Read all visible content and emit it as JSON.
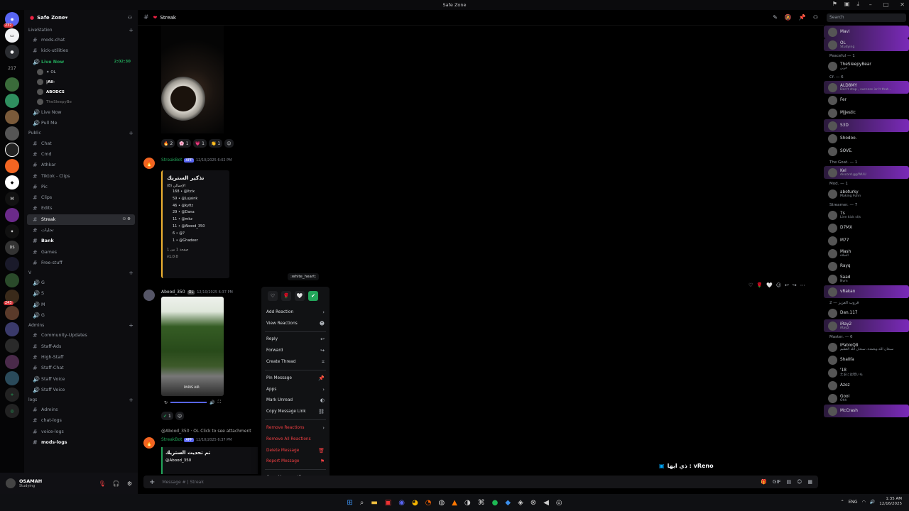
{
  "titlebar": {
    "title": "Safe Zone"
  },
  "server_list": {
    "badge_top": "232",
    "badge_2": "217",
    "badge_3": "243"
  },
  "guild": {
    "name": "Safe Zone"
  },
  "channels": {
    "cat_livestation": "LiveStation",
    "mods_chat": "mods-chat",
    "kick_utilities": "kick-utilities",
    "live_now_1": "Live Now",
    "live_now_time": "2:02:30",
    "vc_user_1": "|All-",
    "vc_user_2": "ABODCS",
    "vc_user_3": "TheSleepyBe",
    "live_now_2": "Live Now",
    "pull_me": "Pull Me",
    "cat_public": "Public",
    "chat": "Chat",
    "cmd": "Cmd",
    "athkar": "Athkar",
    "tiktok": "Tiktok - Clips",
    "pic": "Pic",
    "clips": "Clips",
    "edits": "Edits",
    "streak": "Streak",
    "tahliyat": "تحليات",
    "bank": "Bank",
    "games": "Games",
    "free_stuff": "Free-stuff",
    "cat_v": "V",
    "vg1": "G",
    "vs": "S",
    "vm": "M",
    "vg2": "G",
    "cat_admins": "Admins",
    "community_updates": "Community-Updates",
    "staff_ads": "Staff-Ads",
    "high_staff": "High-Staff",
    "staff_chat": "Staff-Chat",
    "staff_voice_1": "Staff Voice",
    "staff_voice_2": "Staff Voice",
    "cat_logs": "logs",
    "admins": "Admins",
    "chat_logs": "chat-logs",
    "voice_logs": "voice-logs",
    "mods_logs": "mods-logs"
  },
  "user_panel": {
    "name": "OSAMAH",
    "status": "Studying"
  },
  "header": {
    "channel": "Streak",
    "search_placeholder": "Search"
  },
  "messages": {
    "reactions": [
      {
        "emoji": "🔥",
        "count": "2"
      },
      {
        "emoji": "🌸",
        "count": "1"
      },
      {
        "emoji": "💗",
        "count": "1"
      },
      {
        "emoji": "👏",
        "count": "1"
      }
    ],
    "bot_name": "StreakBot",
    "app_tag": "APP",
    "bot_time": "12/10/2025 6:02 PM",
    "embed_title": "تذكير الستريك",
    "embed_sub": "الإجمالي (8)",
    "embed_rows": [
      "168 • @Itzix",
      "59 • @Lujaink",
      "46 • @kyfiz",
      "29 • @Dana",
      "11 • @mkz",
      "11 • @Abood_350",
      "6 • @?",
      "1 • @Ghadeer"
    ],
    "embed_page": "صفحة 1 من 1",
    "embed_version": "v1.0.0",
    "user2_name": "Abood_350",
    "user2_tag": "OL",
    "user2_time": "12/10/2025 6:37 PM",
    "img2_caption": "PARIS AIR",
    "reaction2_count": "1",
    "reply_line": "@Abood_350 · OL Click to see attachment",
    "bot2_time": "12/10/2025 6:37 PM",
    "embed2_title": "تم تحديث الستريك",
    "embed2_user": "@Abood_350",
    "composer_placeholder": "Message # | Streak",
    "activity_text": "ذي ابها : vReno"
  },
  "context_menu": {
    "tooltip": ":white_heart:",
    "items": {
      "add_reaction": "Add Reaction",
      "view_reactions": "View Reactions",
      "reply": "Reply",
      "forward": "Forward",
      "create_thread": "Create Thread",
      "pin": "Pin Message",
      "apps": "Apps",
      "mark_unread": "Mark Unread",
      "copy_link": "Copy Message Link",
      "remove_reactions": "Remove Reactions",
      "remove_all": "Remove All Reactions",
      "delete": "Delete Message",
      "report": "Report Message",
      "copy_id": "Copy Message ID"
    }
  },
  "members": {
    "groups": [
      {
        "title": "",
        "items": [
          {
            "name": "Mavi",
            "status": ""
          },
          {
            "name": "OL",
            "status": "Studying"
          }
        ]
      },
      {
        "title": "Peaceful — 1",
        "items": [
          {
            "name": "TheSleepyBear",
            "status": "حزين"
          }
        ]
      },
      {
        "title": "Cf. — 6",
        "items": [
          {
            "name": "ALD8MY",
            "status": "Don't stop , success isn't that..."
          },
          {
            "name": "Fer",
            "status": ""
          },
          {
            "name": "MJjestic",
            "status": ""
          },
          {
            "name": "S3D",
            "status": ""
          },
          {
            "name": "Shodoo.",
            "status": ""
          },
          {
            "name": "SOVE.",
            "status": ""
          }
        ]
      },
      {
        "title": "The Goat. — 1",
        "items": [
          {
            "name": "Kel",
            "status": "discord.gg/WUU"
          }
        ]
      },
      {
        "title": "Mod. — 1",
        "items": [
          {
            "name": "aboturky",
            "status": "Making Funn"
          }
        ]
      },
      {
        "title": "Streamer. — 7",
        "items": [
          {
            "name": "7s",
            "status": "Live kick sl/s"
          },
          {
            "name": "D7MX",
            "status": ""
          },
          {
            "name": "M77",
            "status": ""
          },
          {
            "name": "Mash",
            "status": "الصلاة"
          },
          {
            "name": "Rayq",
            "status": ""
          },
          {
            "name": "Saad",
            "status": "Nvm"
          },
          {
            "name": "vRakan",
            "status": ""
          }
        ]
      },
      {
        "title": "قروب العزيز — 2",
        "items": [
          {
            "name": "Dan.117",
            "status": ""
          },
          {
            "name": "iRay2",
            "status": "iRay2"
          }
        ]
      },
      {
        "title": "Master. — 6",
        "items": [
          {
            "name": "lPabloQ8",
            "status": "سبحان الله وبحمده، سبحان الله العظيم"
          },
          {
            "name": "Shallfa",
            "status": ""
          },
          {
            "name": "'18",
            "status": "たまには暗いも"
          },
          {
            "name": "Azoz",
            "status": ""
          },
          {
            "name": "Gool",
            "status": "Ohh"
          },
          {
            "name": "McCrash",
            "status": ""
          }
        ]
      }
    ]
  },
  "taskbar": {
    "lang": "ENG",
    "time": "1:35 AM",
    "date": "12/16/2025"
  }
}
